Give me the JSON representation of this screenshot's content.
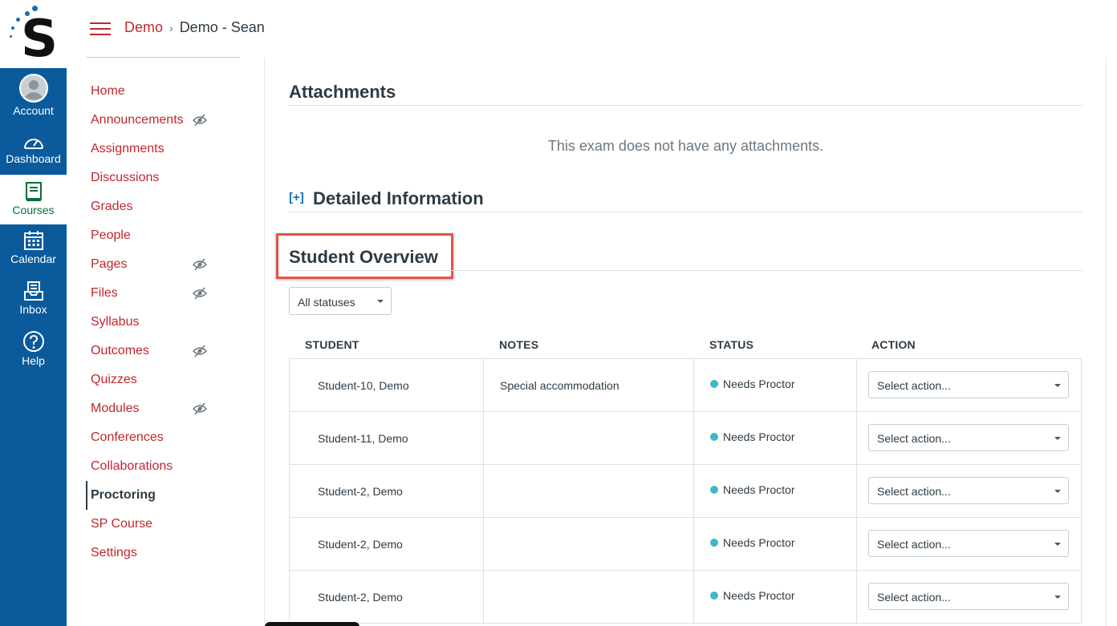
{
  "global_nav": {
    "items": [
      {
        "label": "Account",
        "icon": "account-avatar-icon"
      },
      {
        "label": "Dashboard",
        "icon": "dashboard-gauge-icon"
      },
      {
        "label": "Courses",
        "icon": "courses-book-icon"
      },
      {
        "label": "Calendar",
        "icon": "calendar-icon"
      },
      {
        "label": "Inbox",
        "icon": "inbox-icon"
      },
      {
        "label": "Help",
        "icon": "help-question-icon"
      }
    ],
    "colors": {
      "background": "#0a5a9c",
      "active_text": "#0a6e3c",
      "logo_dot": "#0f6fb8"
    }
  },
  "header": {
    "breadcrumb": [
      "Demo",
      "Demo - Sean"
    ],
    "separator": "›"
  },
  "course_nav": {
    "items": [
      {
        "label": "Home",
        "hidden": false
      },
      {
        "label": "Announcements",
        "hidden": true
      },
      {
        "label": "Assignments",
        "hidden": false
      },
      {
        "label": "Discussions",
        "hidden": false
      },
      {
        "label": "Grades",
        "hidden": false
      },
      {
        "label": "People",
        "hidden": false
      },
      {
        "label": "Pages",
        "hidden": true
      },
      {
        "label": "Files",
        "hidden": true
      },
      {
        "label": "Syllabus",
        "hidden": false
      },
      {
        "label": "Outcomes",
        "hidden": true
      },
      {
        "label": "Quizzes",
        "hidden": false
      },
      {
        "label": "Modules",
        "hidden": true
      },
      {
        "label": "Conferences",
        "hidden": false
      },
      {
        "label": "Collaborations",
        "hidden": false
      },
      {
        "label": "Proctoring",
        "hidden": false,
        "active": true
      },
      {
        "label": "SP Course",
        "hidden": false
      },
      {
        "label": "Settings",
        "hidden": false
      }
    ],
    "link_color": "#c0272d"
  },
  "main": {
    "attachments": {
      "title": "Attachments",
      "empty_message": "This exam does not have any attachments."
    },
    "detailed_info": {
      "toggle": "[+]",
      "title": "Detailed Information"
    },
    "student_overview": {
      "title": "Student Overview",
      "filter": {
        "selected": "All statuses"
      },
      "columns": [
        "STUDENT",
        "NOTES",
        "STATUS",
        "ACTION"
      ],
      "rows": [
        {
          "student": "Student-10, Demo",
          "notes": "Special accommodation",
          "status": "Needs Proctor",
          "action": "Select action..."
        },
        {
          "student": "Student-11, Demo",
          "notes": "",
          "status": "Needs Proctor",
          "action": "Select action..."
        },
        {
          "student": "Student-2, Demo",
          "notes": "",
          "status": "Needs Proctor",
          "action": "Select action..."
        },
        {
          "student": "Student-2, Demo",
          "notes": "",
          "status": "Needs Proctor",
          "action": "Select action..."
        },
        {
          "student": "Student-2, Demo",
          "notes": "",
          "status": "Needs Proctor",
          "action": "Select action..."
        }
      ],
      "status_color": "#3fb6c8",
      "highlight_color": "#e4534a"
    }
  }
}
